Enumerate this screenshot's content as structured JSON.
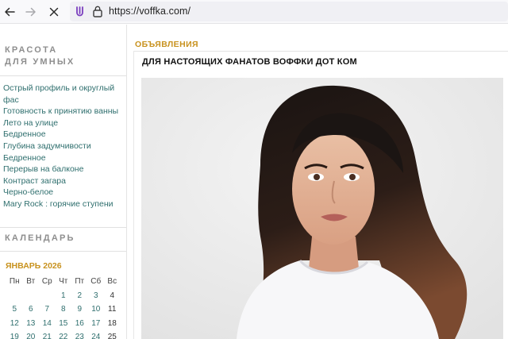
{
  "browser": {
    "url": "https://voffka.com/"
  },
  "sidebar": {
    "heading_line1": "КРАСОТА",
    "heading_line2": "ДЛЯ УМНЫХ",
    "links": [
      "Острый профиль и округлый фас",
      "Готовность к принятию ванны",
      "Лето на улице",
      "Бедренное",
      "Глубина задумчивости",
      "Бедренное",
      "Перерыв на балконе",
      "Контраст загара",
      "Черно-белое",
      "Mary Rock : горячие ступени"
    ],
    "calendar_heading": "КАЛЕНДАРЬ",
    "calendar": {
      "month": "ЯНВАРЬ 2026",
      "weekdays": [
        "Пн",
        "Вт",
        "Ср",
        "Чт",
        "Пт",
        "Сб",
        "Вс"
      ],
      "weeks": [
        [
          "",
          "",
          "",
          "1",
          "2",
          "3",
          "4"
        ],
        [
          "5",
          "6",
          "7",
          "8",
          "9",
          "10",
          "11"
        ],
        [
          "12",
          "13",
          "14",
          "15",
          "16",
          "17",
          "18"
        ],
        [
          "19",
          "20",
          "21",
          "22",
          "23",
          "24",
          "25"
        ]
      ]
    }
  },
  "main": {
    "section_heading": "ОБЪЯВЛЕНИЯ",
    "post_title": "ДЛЯ НАСТОЯЩИХ ФАНАТОВ ВОФФКИ ДОТ КОМ"
  },
  "colors": {
    "accent": "#c8921e",
    "link": "#2f6f6e"
  }
}
